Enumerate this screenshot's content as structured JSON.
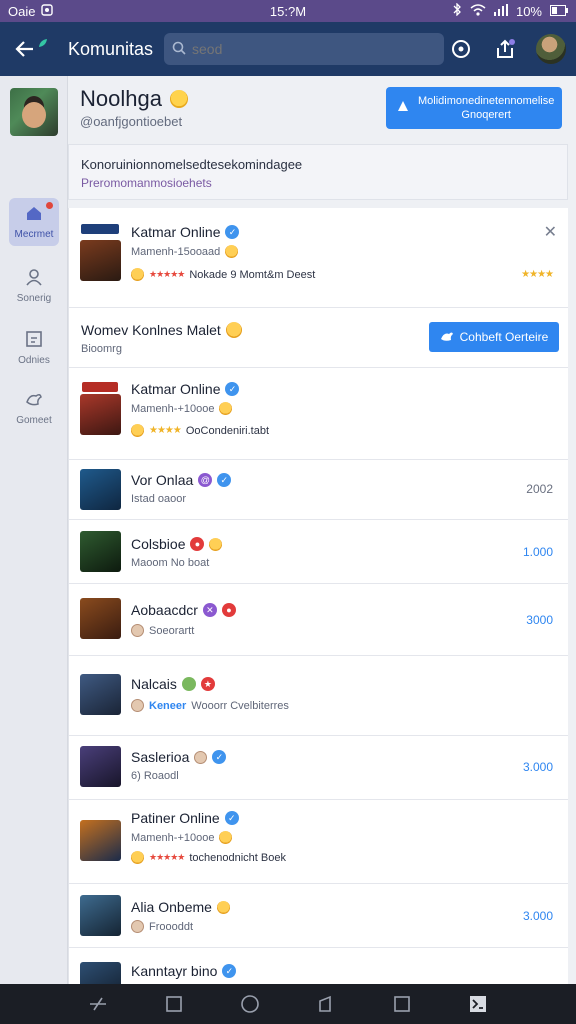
{
  "status_bar": {
    "carrier": "Oaie",
    "time": "15:?M",
    "battery": "10%"
  },
  "app_bar": {
    "title": "Komunitas",
    "search_placeholder": "seod"
  },
  "rail": {
    "items": [
      {
        "label": "Mecrmet"
      },
      {
        "label": "Sonerig"
      },
      {
        "label": "Odnies"
      },
      {
        "label": "Gomeet"
      }
    ]
  },
  "profile": {
    "name": "Noolhga",
    "handle": "@oanfjgontioebet",
    "follow_button": {
      "line1": "Molidimonedinetennomelise",
      "line2": "Gnoqerert"
    }
  },
  "banner": {
    "line1": "Konoruinionnomelsedtesekomindagee",
    "line2": "Preromomanmosioehets"
  },
  "list": {
    "rows": [
      {
        "title": "Katmar Online",
        "subtitle": "Mamenh-15ooaad",
        "meta": "Nokade 9 Momt&m Deest",
        "stars": "★★★★★",
        "right_stars": "★★★★"
      },
      {
        "title": "Womev Konlnes Malet",
        "subtitle": "Bioomrg",
        "cta": "Cohbeft Oerteire"
      },
      {
        "title": "Katmar Online",
        "subtitle": "Mamenh-+10ooe",
        "meta": "OoCondeniri.tabt",
        "stars": "★★★★"
      },
      {
        "title": "Vor Onlaa",
        "subtitle": "Istad oaoor",
        "value": "2002"
      },
      {
        "title": "Colsbioe",
        "subtitle": "Maoom No boat",
        "value": "1.000"
      },
      {
        "title": "Aobaacdcr",
        "subtitle": "Soeorartt",
        "value": "3000"
      },
      {
        "title": "Nalcais",
        "subtitle": "Wooorr Cvelbiterres",
        "subtitle_accent": "Keneer",
        "value": ""
      },
      {
        "title": "Saslerioa",
        "subtitle": "6) Roaodl",
        "value": "3.000"
      },
      {
        "title": "Patiner Online",
        "subtitle": "Mamenh-+10ooe",
        "meta": "tochenodnicht Boek",
        "stars": "★★★★★"
      },
      {
        "title": "Alia Onbeme",
        "subtitle": "Froooddt",
        "value": "3.000"
      },
      {
        "title": "Kanntayr bino",
        "subtitle": ""
      }
    ]
  },
  "colors": {
    "appbar": "#1f3a66",
    "accent": "#2f86f0",
    "statusbar": "#5b4a8a"
  }
}
